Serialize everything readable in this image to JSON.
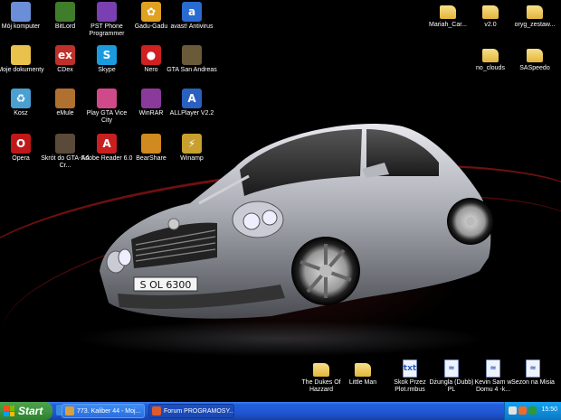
{
  "desktop": {
    "left_icons": [
      {
        "label": "Mój komputer",
        "icon": "computer-icon",
        "color": "#6a8fd8",
        "glyph": ""
      },
      {
        "label": "BitLord",
        "icon": "bitlord-icon",
        "color": "#3f7d2a",
        "glyph": ""
      },
      {
        "label": "PST Phone Programmer",
        "icon": "phone-programmer-icon",
        "color": "#7a3fb0",
        "glyph": ""
      },
      {
        "label": "Gadu-Gadu",
        "icon": "gadu-gadu-icon",
        "color": "#e0a020",
        "glyph": "✿"
      },
      {
        "label": "avast! Antivirus",
        "icon": "avast-icon",
        "color": "#2a6bd0",
        "glyph": "a"
      },
      {
        "label": "Moje dokumenty",
        "icon": "my-documents-icon",
        "color": "#e8c24a",
        "glyph": ""
      },
      {
        "label": "CDex",
        "icon": "cdex-icon",
        "color": "#c0302a",
        "glyph": "ex"
      },
      {
        "label": "Skype",
        "icon": "skype-icon",
        "color": "#1a9be0",
        "glyph": "S"
      },
      {
        "label": "Nero",
        "icon": "nero-icon",
        "color": "#d02020",
        "glyph": "●"
      },
      {
        "label": "GTA San Andreas",
        "icon": "gta-sa-icon",
        "color": "#6b5a3a",
        "glyph": ""
      },
      {
        "label": "Kosz",
        "icon": "recycle-bin-icon",
        "color": "#4aa0d0",
        "glyph": "♻"
      },
      {
        "label": "eMule",
        "icon": "emule-icon",
        "color": "#b07030",
        "glyph": ""
      },
      {
        "label": "Play GTA Vice City",
        "icon": "gta-vice-city-icon",
        "color": "#d04a8a",
        "glyph": ""
      },
      {
        "label": "WinRAR",
        "icon": "winrar-icon",
        "color": "#8a3a9a",
        "glyph": ""
      },
      {
        "label": "ALLPlayer V2.2",
        "icon": "allplayer-icon",
        "color": "#2a60c0",
        "glyph": "A"
      },
      {
        "label": "Opera",
        "icon": "opera-icon",
        "color": "#c01818",
        "glyph": "O"
      },
      {
        "label": "Skrót do GTA-SA Cr...",
        "icon": "gta-sa-shortcut-icon",
        "color": "#5a4a3a",
        "glyph": ""
      },
      {
        "label": "Adobe Reader 6.0",
        "icon": "adobe-reader-icon",
        "color": "#c82020",
        "glyph": "A"
      },
      {
        "label": "BearShare",
        "icon": "bearshare-icon",
        "color": "#d08a20",
        "glyph": ""
      },
      {
        "label": "Winamp",
        "icon": "winamp-icon",
        "color": "#c8a030",
        "glyph": "⚡"
      }
    ],
    "right_icons": [
      {
        "label": "Mariah_Car...",
        "type": "folder"
      },
      {
        "label": "v2.0",
        "type": "folder"
      },
      {
        "label": "oryg_zestaw...",
        "type": "folder"
      },
      {
        "label": "no_clouds",
        "type": "folder"
      },
      {
        "label": "SASpeedo",
        "type": "folder"
      }
    ],
    "bottom_icons": [
      {
        "label": "The Dukes Of Hazzard",
        "type": "folder"
      },
      {
        "label": "Little Man",
        "type": "folder"
      },
      {
        "label": "Skok Przez Plot.rmbus",
        "type": "doc",
        "glyph": "txt"
      },
      {
        "label": "Dżungla (Dubb) PL",
        "type": "doc",
        "glyph": "≈"
      },
      {
        "label": "Kevin Sam w Domu 4 -k...",
        "type": "doc",
        "glyph": "≈"
      },
      {
        "label": "Sezon na Misia",
        "type": "doc",
        "glyph": "≈"
      }
    ],
    "car_plate": "S OL 6300"
  },
  "taskbar": {
    "start_label": "Start",
    "tasks": [
      {
        "label": "773. Kaliber 44 - Moj...",
        "icon_color": "#d8a040"
      },
      {
        "label": "Forum PROGRAMOSY...",
        "icon_color": "#e05a2a"
      }
    ],
    "clock": "15:50"
  }
}
